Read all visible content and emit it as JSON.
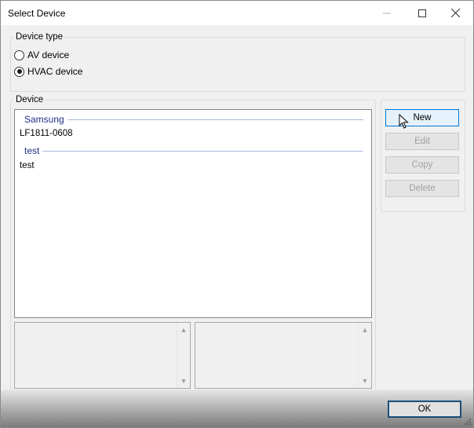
{
  "window": {
    "title": "Select Device",
    "controls": {
      "minimize": "minimize",
      "maximize": "maximize",
      "close": "close"
    }
  },
  "device_type": {
    "label": "Device type",
    "options": [
      {
        "label": "AV device",
        "checked": false
      },
      {
        "label": "HVAC device",
        "checked": true
      }
    ]
  },
  "device": {
    "label": "Device",
    "groups": [
      {
        "header": "Samsung",
        "items": [
          "LF1811-0608"
        ]
      },
      {
        "header": "test",
        "items": [
          "test"
        ]
      }
    ]
  },
  "actions": {
    "new": "New",
    "edit": "Edit",
    "copy": "Copy",
    "delete": "Delete"
  },
  "footer": {
    "ok": "OK"
  },
  "colors": {
    "group_header": "#1e3287",
    "accent_border": "#0078d7",
    "ok_border": "#1b4e78"
  }
}
